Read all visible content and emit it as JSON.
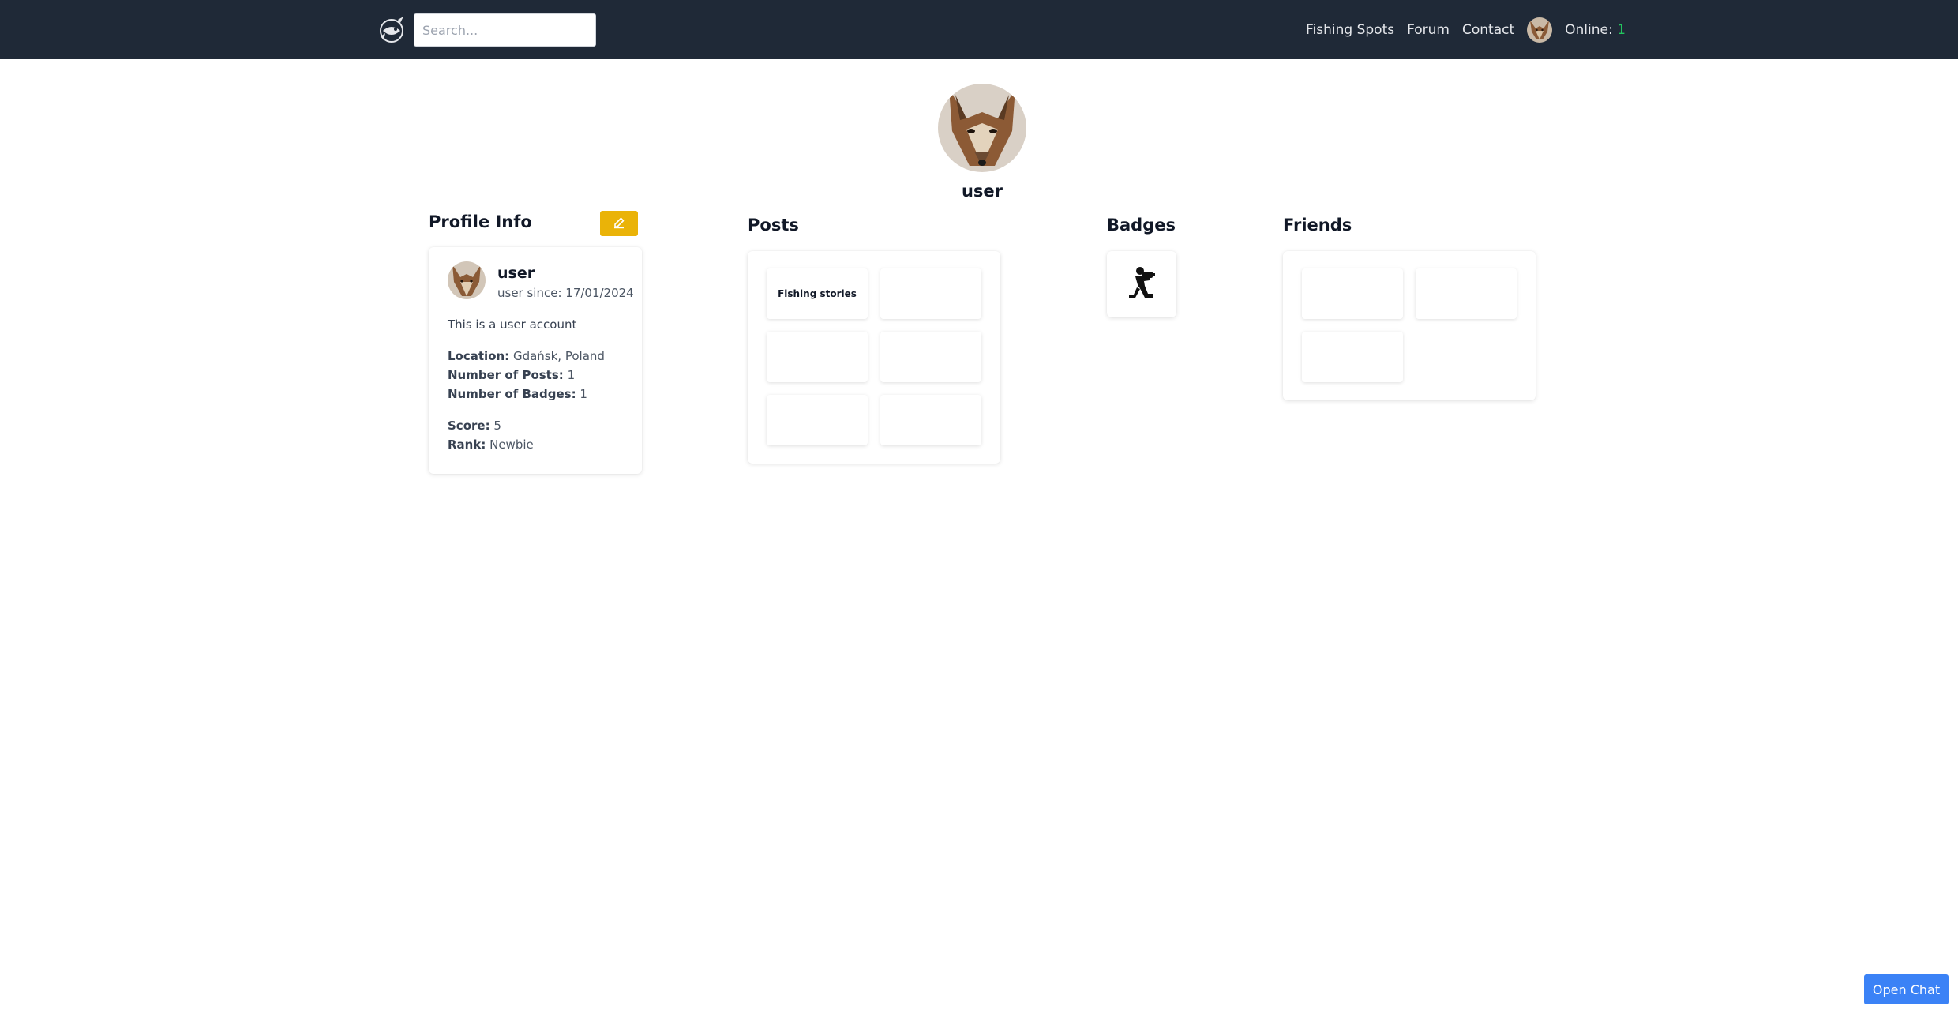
{
  "navbar": {
    "search_placeholder": "Search...",
    "links": [
      "Fishing Spots",
      "Forum",
      "Contact"
    ],
    "online_label": "Online:",
    "online_count": "1"
  },
  "profile": {
    "username": "user"
  },
  "profile_info": {
    "title": "Profile Info",
    "name": "user",
    "since": "user since: 17/01/2024",
    "description": "This is a user account",
    "location_label": "Location:",
    "location": "Gdańsk, Poland",
    "posts_label": "Number of Posts:",
    "posts": "1",
    "badges_label": "Number of Badges:",
    "badges": "1",
    "score_label": "Score:",
    "score": "5",
    "rank_label": "Rank:",
    "rank": "Newbie"
  },
  "posts": {
    "title": "Posts",
    "items": [
      "Fishing stories",
      "",
      "",
      "",
      "",
      ""
    ]
  },
  "badges": {
    "title": "Badges",
    "icon": "kneeling-photographer-icon"
  },
  "friends": {
    "title": "Friends"
  },
  "chat": {
    "button_label": "Open Chat"
  },
  "colors": {
    "navbar": "#1f2937",
    "edit_button": "#eab308",
    "chat_button": "#3b82f6",
    "online_count": "#22c55e"
  }
}
